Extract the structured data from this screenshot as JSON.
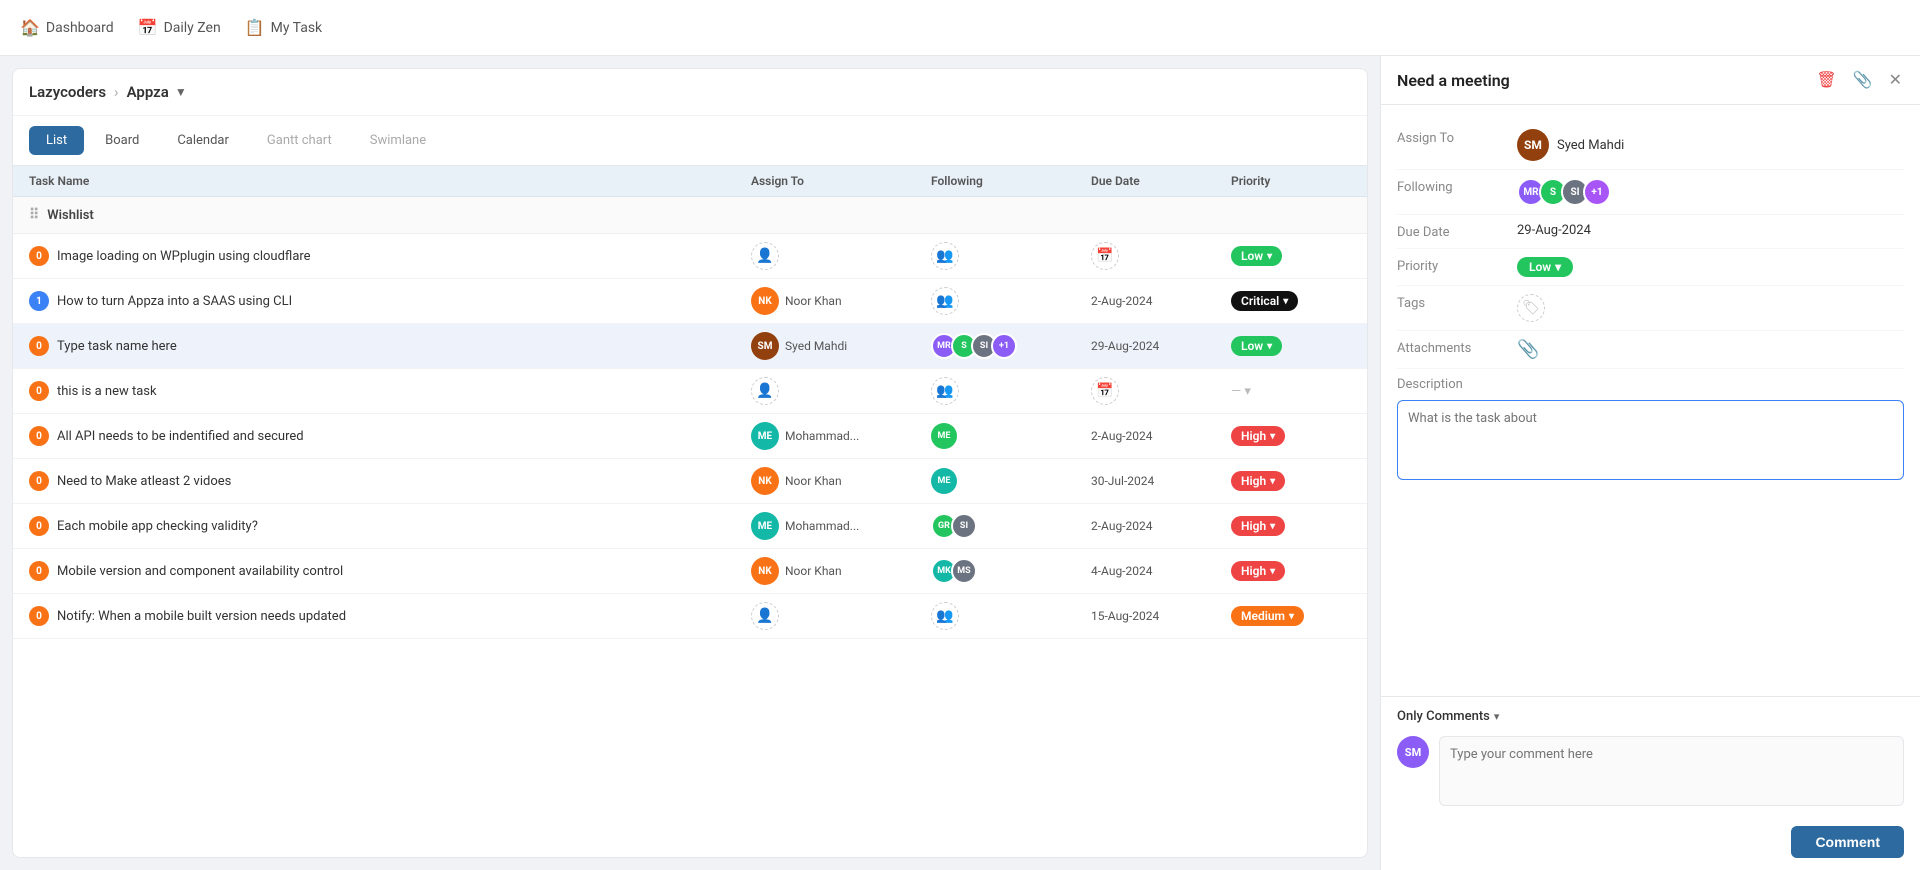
{
  "nav": {
    "dashboard": "Dashboard",
    "daily_zen": "Daily Zen",
    "my_task": "My Task"
  },
  "breadcrumb": {
    "org": "Lazycoders",
    "project": "Appza"
  },
  "view_tabs": [
    {
      "id": "list",
      "label": "List",
      "state": "active"
    },
    {
      "id": "board",
      "label": "Board",
      "state": "default"
    },
    {
      "id": "calendar",
      "label": "Calendar",
      "state": "default"
    },
    {
      "id": "gantt",
      "label": "Gantt chart",
      "state": "inactive"
    },
    {
      "id": "swimlane",
      "label": "Swimlane",
      "state": "inactive"
    }
  ],
  "table_headers": {
    "task_name": "Task Name",
    "assign_to": "Assign To",
    "following": "Following",
    "due_date": "Due Date",
    "priority": "Priority"
  },
  "groups": [
    {
      "name": "Wishlist",
      "tasks": [
        {
          "num": "0",
          "name": "Image loading on WPplugin using cloudflare",
          "assign": null,
          "following": null,
          "due_date": null,
          "priority": "Low",
          "priority_class": "low"
        },
        {
          "num": "1",
          "num_class": "blue",
          "name": "How to turn Appza into a SAAS using CLI",
          "assign": "Noor Khan",
          "assign_initials": "NK",
          "assign_color": "av-orange",
          "following": null,
          "due_date": "2-Aug-2024",
          "priority": "Critical",
          "priority_class": "critical"
        },
        {
          "num": "0",
          "name": "Type task name here",
          "assign": "Syed Mahdi",
          "assign_initials": "SM",
          "assign_color": "av-brown",
          "following": "multi",
          "due_date": "29-Aug-2024",
          "priority": "Low",
          "priority_class": "low",
          "highlighted": true
        },
        {
          "num": "0",
          "name": "this is a new task",
          "assign": null,
          "following": null,
          "due_date": null,
          "priority": null,
          "priority_class": ""
        },
        {
          "num": "0",
          "name": "All API needs to be indentified and secured",
          "assign": "Mohammad...",
          "assign_initials": "ME",
          "assign_color": "av-teal",
          "following": "single",
          "due_date": "2-Aug-2024",
          "priority": "High",
          "priority_class": "high"
        },
        {
          "num": "0",
          "name": "Need to Make atleast 2 vidoes",
          "assign": "Noor Khan",
          "assign_initials": "NK",
          "assign_color": "av-orange",
          "following": "me",
          "due_date": "30-Jul-2024",
          "priority": "High",
          "priority_class": "high"
        },
        {
          "num": "0",
          "name": "Each mobile app checking validity?",
          "assign": "Mohammad...",
          "assign_initials": "ME",
          "assign_color": "av-teal",
          "following": "two",
          "due_date": "2-Aug-2024",
          "priority": "High",
          "priority_class": "high"
        },
        {
          "num": "0",
          "name": "Mobile version and component availability control",
          "assign": "Noor Khan",
          "assign_initials": "NK",
          "assign_color": "av-orange",
          "following": "two_b",
          "due_date": "4-Aug-2024",
          "priority": "High",
          "priority_class": "high"
        },
        {
          "num": "0",
          "name": "Notify: When a mobile built version needs updated",
          "assign": null,
          "following": null,
          "due_date": "15-Aug-2024",
          "priority": "Medium",
          "priority_class": "medium"
        }
      ]
    }
  ],
  "detail_panel": {
    "title": "Need a meeting",
    "assign_to_label": "Assign To",
    "assign_to_name": "Syed Mahdi",
    "assign_initials": "SM",
    "following_label": "Following",
    "followers": [
      "MR",
      "S2",
      "SI"
    ],
    "follower_colors": [
      "av-purple",
      "av-green",
      "av-gray"
    ],
    "follower_plus": "+1",
    "due_date_label": "Due Date",
    "due_date_value": "29-Aug-2024",
    "priority_label": "Priority",
    "priority_value": "Low",
    "tags_label": "Tags",
    "attachments_label": "Attachments",
    "description_label": "Description",
    "description_placeholder": "What is the task about",
    "comments_filter": "Only Comments",
    "comment_placeholder": "Type your comment here",
    "comment_button": "Comment"
  }
}
